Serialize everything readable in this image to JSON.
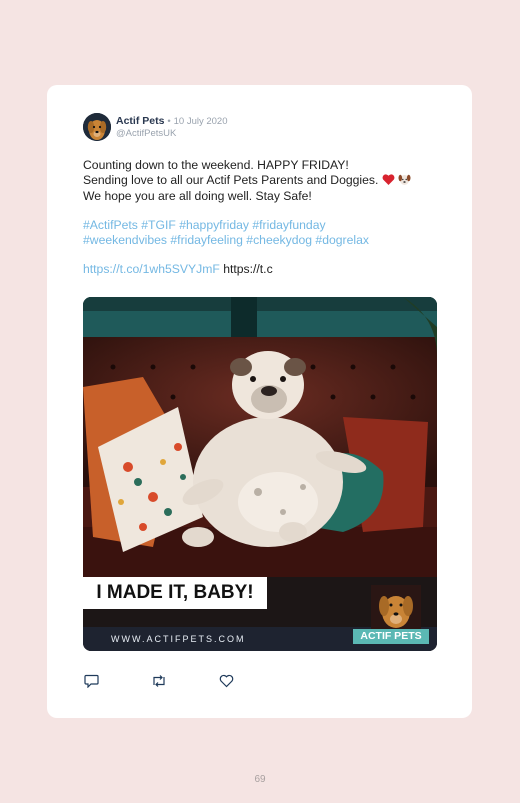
{
  "tweet": {
    "name": "Actif Pets",
    "separator": "•",
    "date": "10 July 2020",
    "handle": "@ActifPetsUK",
    "line1": "Counting down to the weekend. HAPPY FRIDAY!",
    "line2": "Sending love to all our Actif Pets Parents and Doggies.",
    "line3": "We hope you are all doing well. Stay Safe!",
    "hashtags_line1": [
      "#ActifPets",
      "#TGIF",
      "#happyfriday",
      "#fridayfunday"
    ],
    "hashtags_line2": [
      "#weekendvibes",
      "#fridayfeeling",
      "#cheekydog",
      "#dogrelax"
    ],
    "link1": "https://t.co/1wh5SVYJmF",
    "link2": "https://t.c"
  },
  "image": {
    "caption": "I MADE IT, BABY!",
    "website": "WWW.ACTIFPETS.COM",
    "brand": "ACTIF PETS"
  },
  "actions": {
    "reply_icon": "reply-icon",
    "retweet_icon": "retweet-icon",
    "like_icon": "heart-icon"
  },
  "page_number": "69",
  "colors": {
    "background": "#f5e4e3",
    "hashtag": "#74b8e3",
    "brand_teal": "#5bb8b4"
  }
}
